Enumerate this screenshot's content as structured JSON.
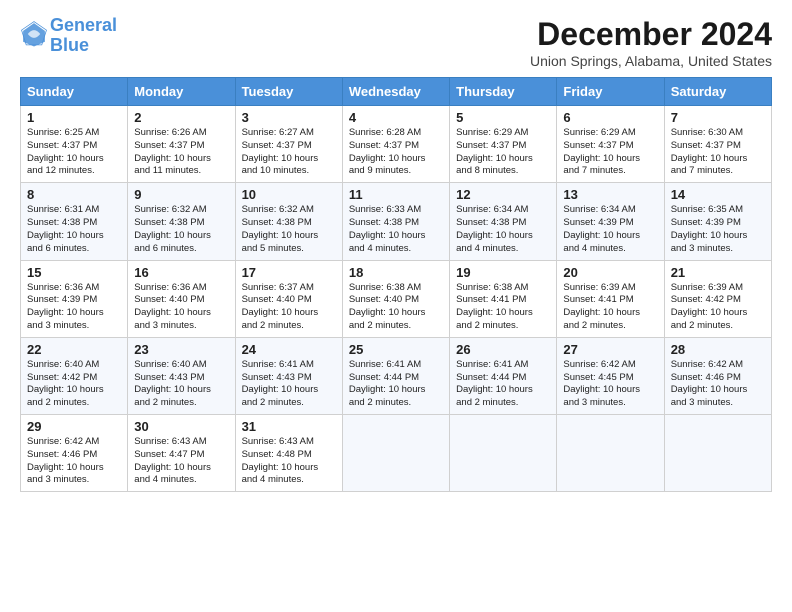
{
  "logo": {
    "line1": "General",
    "line2": "Blue"
  },
  "title": "December 2024",
  "subtitle": "Union Springs, Alabama, United States",
  "days_of_week": [
    "Sunday",
    "Monday",
    "Tuesday",
    "Wednesday",
    "Thursday",
    "Friday",
    "Saturday"
  ],
  "weeks": [
    [
      {
        "day": "1",
        "info": "Sunrise: 6:25 AM\nSunset: 4:37 PM\nDaylight: 10 hours\nand 12 minutes."
      },
      {
        "day": "2",
        "info": "Sunrise: 6:26 AM\nSunset: 4:37 PM\nDaylight: 10 hours\nand 11 minutes."
      },
      {
        "day": "3",
        "info": "Sunrise: 6:27 AM\nSunset: 4:37 PM\nDaylight: 10 hours\nand 10 minutes."
      },
      {
        "day": "4",
        "info": "Sunrise: 6:28 AM\nSunset: 4:37 PM\nDaylight: 10 hours\nand 9 minutes."
      },
      {
        "day": "5",
        "info": "Sunrise: 6:29 AM\nSunset: 4:37 PM\nDaylight: 10 hours\nand 8 minutes."
      },
      {
        "day": "6",
        "info": "Sunrise: 6:29 AM\nSunset: 4:37 PM\nDaylight: 10 hours\nand 7 minutes."
      },
      {
        "day": "7",
        "info": "Sunrise: 6:30 AM\nSunset: 4:37 PM\nDaylight: 10 hours\nand 7 minutes."
      }
    ],
    [
      {
        "day": "8",
        "info": "Sunrise: 6:31 AM\nSunset: 4:38 PM\nDaylight: 10 hours\nand 6 minutes."
      },
      {
        "day": "9",
        "info": "Sunrise: 6:32 AM\nSunset: 4:38 PM\nDaylight: 10 hours\nand 6 minutes."
      },
      {
        "day": "10",
        "info": "Sunrise: 6:32 AM\nSunset: 4:38 PM\nDaylight: 10 hours\nand 5 minutes."
      },
      {
        "day": "11",
        "info": "Sunrise: 6:33 AM\nSunset: 4:38 PM\nDaylight: 10 hours\nand 4 minutes."
      },
      {
        "day": "12",
        "info": "Sunrise: 6:34 AM\nSunset: 4:38 PM\nDaylight: 10 hours\nand 4 minutes."
      },
      {
        "day": "13",
        "info": "Sunrise: 6:34 AM\nSunset: 4:39 PM\nDaylight: 10 hours\nand 4 minutes."
      },
      {
        "day": "14",
        "info": "Sunrise: 6:35 AM\nSunset: 4:39 PM\nDaylight: 10 hours\nand 3 minutes."
      }
    ],
    [
      {
        "day": "15",
        "info": "Sunrise: 6:36 AM\nSunset: 4:39 PM\nDaylight: 10 hours\nand 3 minutes."
      },
      {
        "day": "16",
        "info": "Sunrise: 6:36 AM\nSunset: 4:40 PM\nDaylight: 10 hours\nand 3 minutes."
      },
      {
        "day": "17",
        "info": "Sunrise: 6:37 AM\nSunset: 4:40 PM\nDaylight: 10 hours\nand 2 minutes."
      },
      {
        "day": "18",
        "info": "Sunrise: 6:38 AM\nSunset: 4:40 PM\nDaylight: 10 hours\nand 2 minutes."
      },
      {
        "day": "19",
        "info": "Sunrise: 6:38 AM\nSunset: 4:41 PM\nDaylight: 10 hours\nand 2 minutes."
      },
      {
        "day": "20",
        "info": "Sunrise: 6:39 AM\nSunset: 4:41 PM\nDaylight: 10 hours\nand 2 minutes."
      },
      {
        "day": "21",
        "info": "Sunrise: 6:39 AM\nSunset: 4:42 PM\nDaylight: 10 hours\nand 2 minutes."
      }
    ],
    [
      {
        "day": "22",
        "info": "Sunrise: 6:40 AM\nSunset: 4:42 PM\nDaylight: 10 hours\nand 2 minutes."
      },
      {
        "day": "23",
        "info": "Sunrise: 6:40 AM\nSunset: 4:43 PM\nDaylight: 10 hours\nand 2 minutes."
      },
      {
        "day": "24",
        "info": "Sunrise: 6:41 AM\nSunset: 4:43 PM\nDaylight: 10 hours\nand 2 minutes."
      },
      {
        "day": "25",
        "info": "Sunrise: 6:41 AM\nSunset: 4:44 PM\nDaylight: 10 hours\nand 2 minutes."
      },
      {
        "day": "26",
        "info": "Sunrise: 6:41 AM\nSunset: 4:44 PM\nDaylight: 10 hours\nand 2 minutes."
      },
      {
        "day": "27",
        "info": "Sunrise: 6:42 AM\nSunset: 4:45 PM\nDaylight: 10 hours\nand 3 minutes."
      },
      {
        "day": "28",
        "info": "Sunrise: 6:42 AM\nSunset: 4:46 PM\nDaylight: 10 hours\nand 3 minutes."
      }
    ],
    [
      {
        "day": "29",
        "info": "Sunrise: 6:42 AM\nSunset: 4:46 PM\nDaylight: 10 hours\nand 3 minutes."
      },
      {
        "day": "30",
        "info": "Sunrise: 6:43 AM\nSunset: 4:47 PM\nDaylight: 10 hours\nand 4 minutes."
      },
      {
        "day": "31",
        "info": "Sunrise: 6:43 AM\nSunset: 4:48 PM\nDaylight: 10 hours\nand 4 minutes."
      },
      null,
      null,
      null,
      null
    ]
  ]
}
